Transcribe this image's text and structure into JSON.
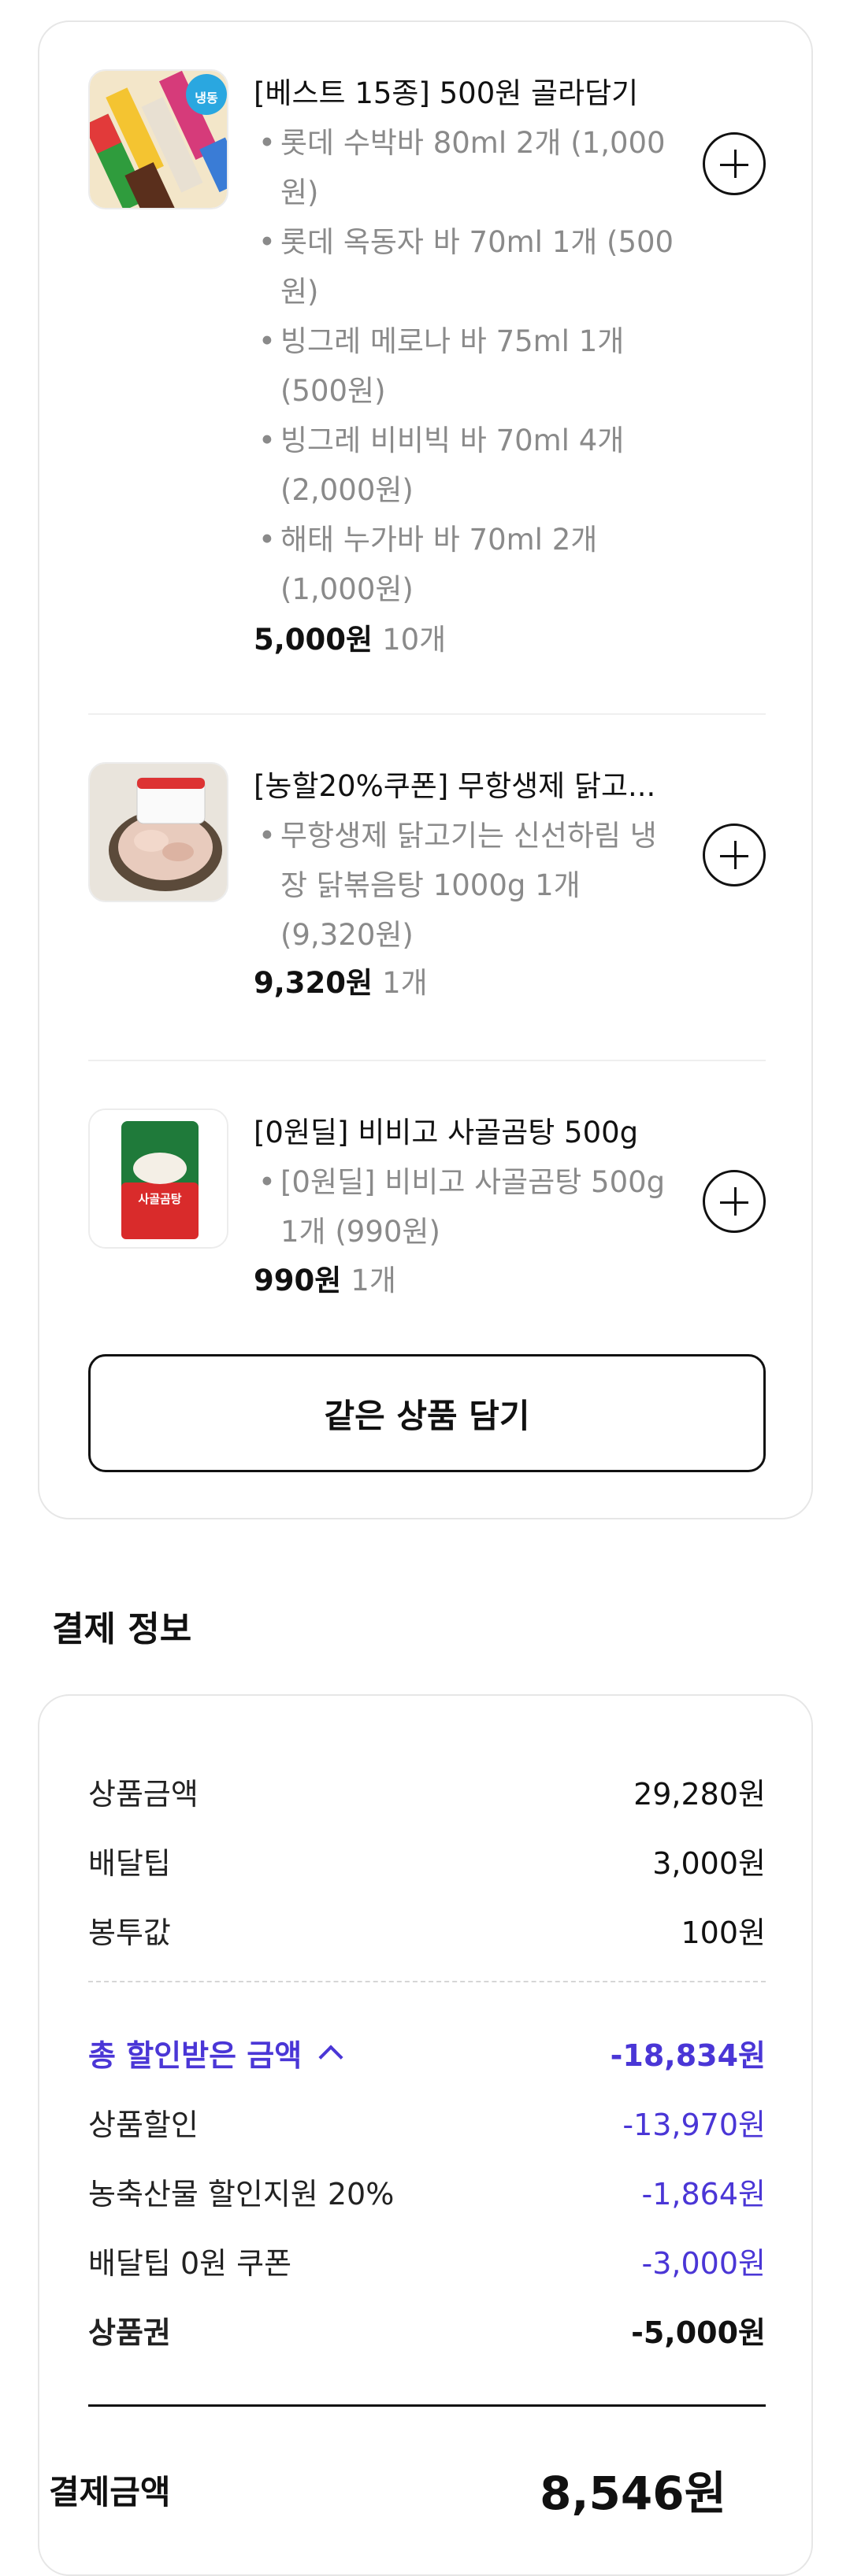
{
  "order_items": [
    {
      "title": "[베스트 15종] 500원 골라담기",
      "image_badge": "냉동",
      "options": [
        "롯데 수박바 80ml 2개 (1,000원)",
        "롯데 옥동자 바 70ml 1개 (500원)",
        "빙그레 메로나 바 75ml 1개 (500원)",
        "빙그레 비비빅 바 70ml 4개 (2,000원)",
        "해태 누가바 바 70ml 2개 (1,000원)"
      ],
      "price": "5,000원",
      "quantity": "10개"
    },
    {
      "title": "[농할20%쿠폰] 무항생제 닭고...",
      "options": [
        "무항생제 닭고기는 신선하림 냉장 닭볶음탕 1000g 1개 (9,320원)"
      ],
      "price": "9,320원",
      "quantity": "1개"
    },
    {
      "title": "[0원딜] 비비고 사골곰탕 500g",
      "image_text": "사골곰탕",
      "options": [
        "[0원딜] 비비고 사골곰탕 500g 1개 (990원)"
      ],
      "price": "990원",
      "quantity": "1개"
    }
  ],
  "same_items_button": "같은 상품 담기",
  "payment": {
    "heading": "결제 정보",
    "rows": [
      {
        "label": "상품금액",
        "value": "29,280원"
      },
      {
        "label": "배달팁",
        "value": "3,000원"
      },
      {
        "label": "봉투값",
        "value": "100원"
      }
    ],
    "total_discount": {
      "label": "총 할인받은 금액",
      "value": "-18,834원"
    },
    "discounts": [
      {
        "label": "상품할인",
        "value": "-13,970원"
      },
      {
        "label": "농축산물 할인지원 20%",
        "value": "-1,864원"
      },
      {
        "label": "배달팁 0원 쿠폰",
        "value": "-3,000원"
      }
    ],
    "voucher": {
      "label": "상품권",
      "value": "-5,000원"
    },
    "final": {
      "label": "결제금액",
      "value": "8,546원"
    }
  },
  "colors": {
    "accent": "#4a36d6",
    "border": "#e6e6e6",
    "muted": "#8a8a8a"
  }
}
